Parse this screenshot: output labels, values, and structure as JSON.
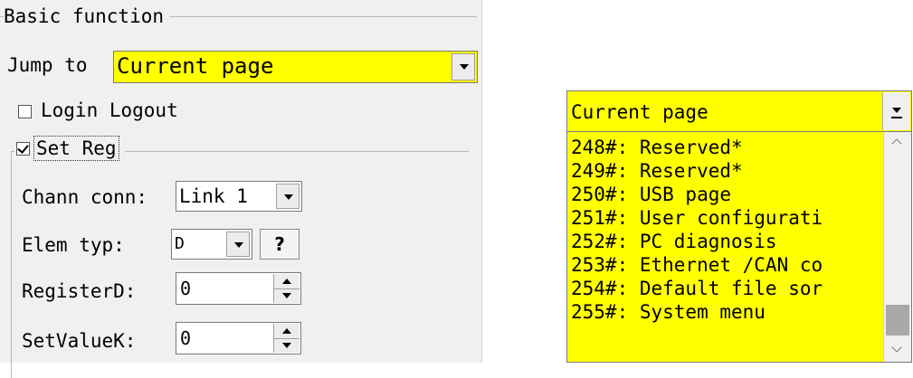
{
  "basic_function": {
    "group_title": "Basic function",
    "jump_to_label": "Jump to",
    "jump_to_value": "Current page",
    "login_logout_label": "Login Logout",
    "login_logout_checked": false
  },
  "set_reg": {
    "label": "Set Reg",
    "checked": true,
    "chann_conn_label": "Chann conn:",
    "chann_conn_value": "Link 1",
    "elem_typ_label": "Elem typ:",
    "elem_typ_value": "D",
    "help_button_label": "?",
    "register_label": "RegisterD:",
    "register_value": "0",
    "set_value_label": "SetValueK:",
    "set_value_value": "0"
  },
  "dropdown": {
    "selected": "Current page",
    "items": [
      "248#: Reserved*",
      "249#: Reserved*",
      "250#: USB page",
      "251#: User configurati",
      "252#: PC diagnosis",
      "253#: Ethernet /CAN co",
      "254#: Default file sor",
      "255#: System menu"
    ]
  },
  "colors": {
    "highlight": "#ffff00",
    "panel_bg": "#f0f0f0"
  }
}
